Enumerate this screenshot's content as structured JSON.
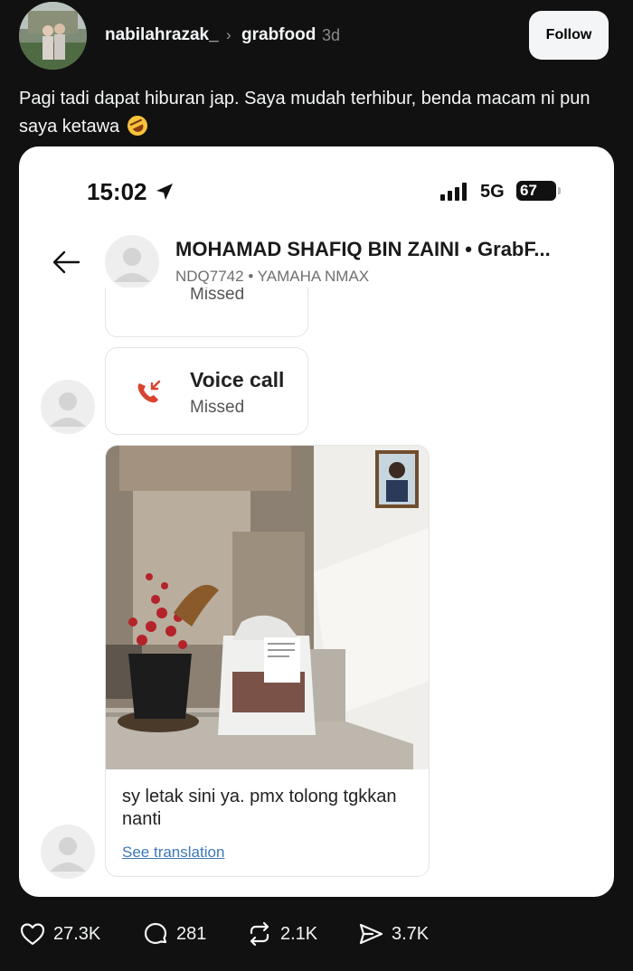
{
  "post": {
    "username": "nabilahrazak_",
    "chevron": "›",
    "community": "grabfood",
    "time": "3d",
    "follow_label": "Follow",
    "caption": "Pagi tadi dapat hiburan jap. Saya mudah terhibur, benda macam ni pun saya ketawa"
  },
  "phone": {
    "status_time": "15:02",
    "network": "5G",
    "battery": "67"
  },
  "chat": {
    "contact_name": "MOHAMAD SHAFIQ BIN ZAINI • GrabF...",
    "contact_sub": "NDQ7742 • YAMAHA NMAX",
    "cut_bubble_text": "Missed",
    "call_title": "Voice call",
    "call_status": "Missed",
    "message": "sy letak sini ya. pmx tolong tgkkan nanti",
    "translation_link": "See translation"
  },
  "actions": {
    "likes": "27.3K",
    "comments": "281",
    "reposts": "2.1K",
    "shares": "3.7K"
  },
  "colors": {
    "background": "#111111",
    "card": "#ffffff",
    "link": "#3d79b8",
    "call_red": "#d9432f"
  },
  "icons": [
    "heart-icon",
    "comment-icon",
    "repost-icon",
    "share-icon",
    "back-arrow-icon",
    "location-arrow-icon",
    "signal-icon",
    "missed-call-icon"
  ]
}
